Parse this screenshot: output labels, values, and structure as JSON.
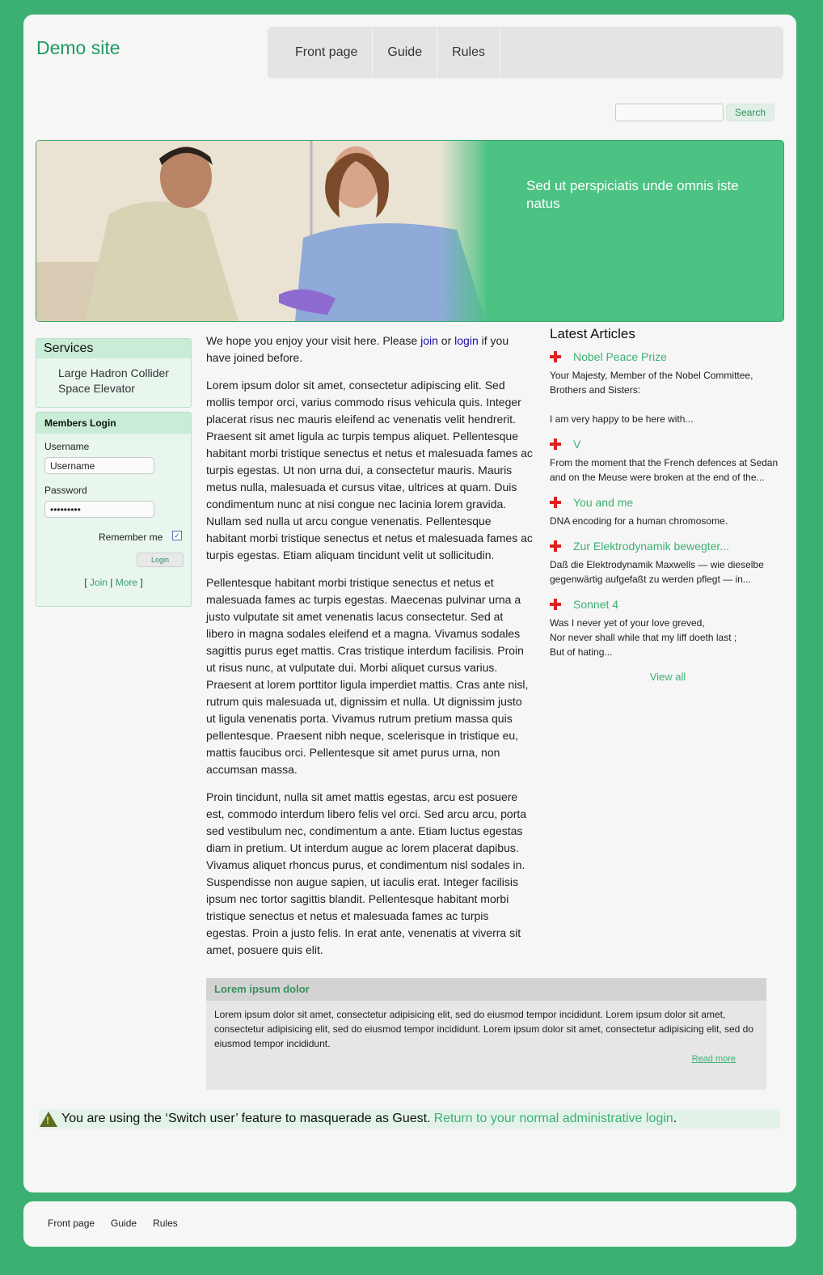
{
  "header": {
    "site_title": "Demo site",
    "nav": [
      "Front page",
      "Guide",
      "Rules"
    ]
  },
  "search": {
    "placeholder": "",
    "button": "Search"
  },
  "banner": {
    "text": "Sed ut perspiciatis unde omnis iste natus"
  },
  "services": {
    "title": "Services",
    "items": [
      "Large Hadron Collider",
      "Space Elevator"
    ]
  },
  "login": {
    "title": "Members Login",
    "username_label": "Username",
    "username_value": "Username",
    "password_label": "Password",
    "password_value": "•••••••••",
    "remember_label": "Remember me",
    "remember_checked": true,
    "button": "Login",
    "link_join": "Join",
    "link_more": "More"
  },
  "main": {
    "intro_before": "We hope you enjoy your visit here. Please ",
    "intro_join": "join",
    "intro_or": " or ",
    "intro_login": "login",
    "intro_after": " if you have joined before.",
    "paragraphs": [
      "Lorem ipsum dolor sit amet, consectetur adipiscing elit. Sed mollis tempor orci, varius commodo risus vehicula quis. Integer placerat risus nec mauris eleifend ac venenatis velit hendrerit. Praesent sit amet ligula ac turpis tempus aliquet. Pellentesque habitant morbi tristique senectus et netus et malesuada fames ac turpis egestas. Ut non urna dui, a consectetur mauris. Mauris metus nulla, malesuada et cursus vitae, ultrices at quam. Duis condimentum nunc at nisi congue nec lacinia lorem gravida. Nullam sed nulla ut arcu congue venenatis. Pellentesque habitant morbi tristique senectus et netus et malesuada fames ac turpis egestas. Etiam aliquam tincidunt velit ut sollicitudin.",
      "Pellentesque habitant morbi tristique senectus et netus et malesuada fames ac turpis egestas. Maecenas pulvinar urna a justo vulputate sit amet venenatis lacus consectetur. Sed at libero in magna sodales eleifend et a magna. Vivamus sodales sagittis purus eget mattis. Cras tristique interdum facilisis. Proin ut risus nunc, at vulputate dui. Morbi aliquet cursus varius. Praesent at lorem porttitor ligula imperdiet mattis. Cras ante nisl, rutrum quis malesuada ut, dignissim et nulla. Ut dignissim justo ut ligula venenatis porta. Vivamus rutrum pretium massa quis pellentesque. Praesent nibh neque, scelerisque in tristique eu, mattis faucibus orci. Pellentesque sit amet purus urna, non accumsan massa.",
      "Proin tincidunt, nulla sit amet mattis egestas, arcu est posuere est, commodo interdum libero felis vel orci. Sed arcu arcu, porta sed vestibulum nec, condimentum a ante. Etiam luctus egestas diam in pretium. Ut interdum augue ac lorem placerat dapibus. Vivamus aliquet rhoncus purus, et condimentum nisl sodales in. Suspendisse non augue sapien, ut iaculis erat. Integer facilisis ipsum nec tortor sagittis blandit. Pellentesque habitant morbi tristique senectus et netus et malesuada fames ac turpis egestas. Proin a justo felis. In erat ante, venenatis at viverra sit amet, posuere quis elit."
    ]
  },
  "latest": {
    "title": "Latest Articles",
    "articles": [
      {
        "title": "Nobel Peace Prize",
        "summary": "Your Majesty, Member of the Nobel Committee, Brothers and Sisters:\n\nI am very happy to be here with..."
      },
      {
        "title": "V",
        "summary": "From the moment that the French defences at Sedan and on the Meuse were broken at the end of the..."
      },
      {
        "title": "You and me",
        "summary": "DNA encoding for a human chromosome."
      },
      {
        "title": "Zur Elektrodynamik bewegter...",
        "summary": "Daß die Elektrodynamik Maxwells — wie dieselbe gegenwärtig aufgefaßt zu werden pflegt — in..."
      },
      {
        "title": "Sonnet 4",
        "summary": "Was I never yet of your love greved,\nNor never shall while that my liff doeth last ;\nBut of hating..."
      }
    ],
    "view_all": "View all"
  },
  "lorem_box": {
    "title": "Lorem ipsum dolor",
    "body": "Lorem ipsum dolor sit amet, consectetur adipisicing elit, sed do eiusmod tempor incididunt. Lorem ipsum dolor sit amet, consectetur adipisicing elit, sed do eiusmod tempor incididunt. Lorem ipsum dolor sit amet, consectetur adipisicing elit, sed do eiusmod tempor incididunt.",
    "read_more": "Read more"
  },
  "switch_notice": {
    "text": "You are using the ‘Switch user’ feature to masquerade as Guest.",
    "link": "Return to your normal administrative login",
    "link_suffix": "."
  },
  "footer": {
    "nav": [
      "Front page",
      "Guide",
      "Rules"
    ]
  },
  "colors": {
    "background": "#3cb072",
    "accent": "#4cc283",
    "link_green": "#3cb072",
    "title_green": "#1e9a63"
  }
}
